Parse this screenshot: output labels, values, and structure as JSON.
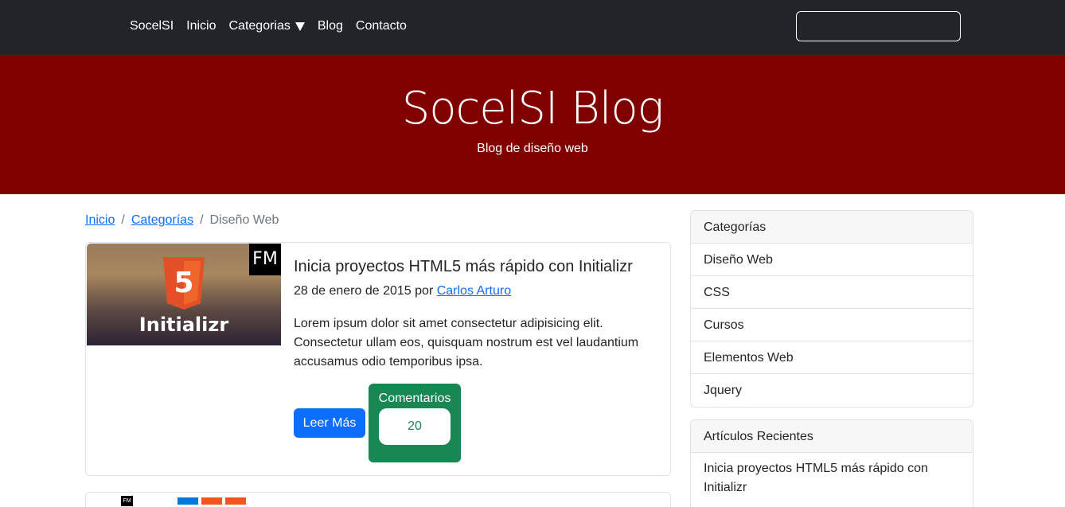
{
  "navbar": {
    "brand": "SocelSI",
    "links": [
      "Inicio",
      "Categorias",
      "Blog",
      "Contacto"
    ],
    "search_value": ""
  },
  "hero": {
    "title": "SocelSI Blog",
    "subtitle": "Blog de diseño web"
  },
  "breadcrumb": {
    "items": [
      "Inicio",
      "Categorías",
      "Diseño Web"
    ]
  },
  "post": {
    "image_caption": "Initializr",
    "image_badge": "FM",
    "image_logo_number": "5",
    "title": "Inicia proyectos HTML5 más rápido con Initializr",
    "date": "28 de enero de 2015",
    "by": "por",
    "author": "Carlos Arturo",
    "excerpt": "Lorem ipsum dolor sit amet consectetur adipisicing elit. Consectetur ullam eos, quisquam nostrum est vel laudantium accusamus odio temporibus ipsa.",
    "read_more": "Leer Más",
    "comments_label": "Comentarios",
    "comments_count": "20"
  },
  "next_post": {
    "image_badge": "FM"
  },
  "sidebar": {
    "categories": {
      "title": "Categorías",
      "items": [
        "Diseño Web",
        "CSS",
        "Cursos",
        "Elementos Web",
        "Jquery"
      ]
    },
    "recent": {
      "title": "Artículos Recientes",
      "items": [
        "Inicia proyectos HTML5 más rápido con Initializr"
      ]
    }
  },
  "colors": {
    "navbar": "#212529",
    "hero": "#800000",
    "primary": "#0d6efd",
    "success": "#198754"
  }
}
